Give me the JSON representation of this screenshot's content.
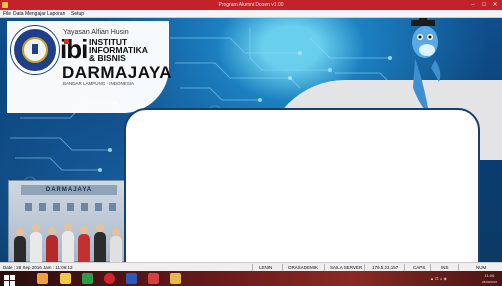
{
  "window": {
    "title": "Program Alumni Dosen v1.00"
  },
  "menu": [
    "File",
    "Data Mengajar",
    "Laporan",
    "Setup"
  ],
  "branding": {
    "foundation": "Yayasan Alfian Husin",
    "acronym": "ibi",
    "institute_lines": [
      "INSTITUT",
      "INFORMATIKA",
      "& BISNIS"
    ],
    "name": "DARMAJAYA",
    "location": "BANDAR LAMPUNG - INDONESIA",
    "building_sign": "DARMAJAYA"
  },
  "statusbar": {
    "datetime": "Date : 28 Sep 2016 Jam : 11:06:13",
    "user": "LENIN",
    "dept": "ORASADEMIK",
    "server": "SAILA SERVER",
    "ip": "179.5.23.157",
    "caps": "CAPS",
    "ins": "INS",
    "num": "NUM"
  },
  "taskbar": {
    "apps": [
      "windows-start-icon",
      "folder-icon",
      "file-explorer-icon",
      "green-app-icon",
      "opera-icon",
      "word-icon",
      "red-app-icon",
      "yellow-app-icon"
    ],
    "clock": "11:06",
    "date": "28/09/2016"
  },
  "colors": {
    "titlebar": "#c2232b",
    "desktop": "#0d3f6e",
    "card_border": "#1b3f6b",
    "taskbar": "#6b1b1b"
  }
}
